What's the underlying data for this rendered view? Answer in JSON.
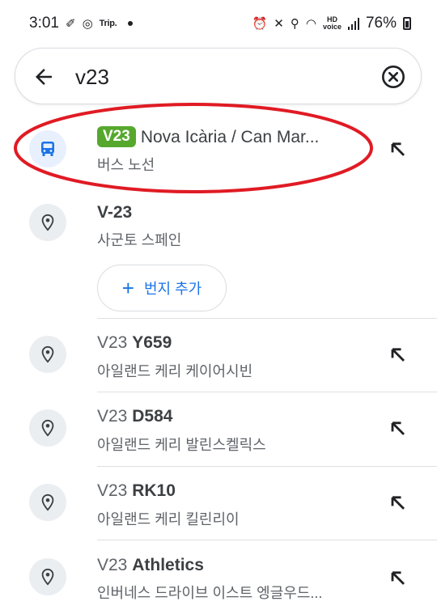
{
  "status_bar": {
    "time": "3:01",
    "mini_label": "Trip.",
    "battery": "76%"
  },
  "search": {
    "value": "v23",
    "placeholder": ""
  },
  "results": {
    "first": {
      "badge": "V23",
      "title": "Nova Icària / Can Mar...",
      "subtitle": "버스 노선"
    },
    "second": {
      "title": "V-23",
      "subtitle": "사군토 스페인",
      "add_address_label": "번지 추가"
    },
    "items": [
      {
        "query": "V23",
        "rest": "Y659",
        "subtitle": "아일랜드 케리 케이어시빈"
      },
      {
        "query": "V23",
        "rest": "D584",
        "subtitle": "아일랜드 케리 발린스켈릭스"
      },
      {
        "query": "V23",
        "rest": "RK10",
        "subtitle": "아일랜드 케리 킬린리이"
      },
      {
        "query": "V23",
        "rest": "Athletics",
        "subtitle": "인버네스 드라이브 이스트 엥글우드..."
      }
    ]
  },
  "colors": {
    "badge_green": "#56a82d",
    "accent_blue": "#1a73e8",
    "annotation_red": "#e01b24"
  }
}
